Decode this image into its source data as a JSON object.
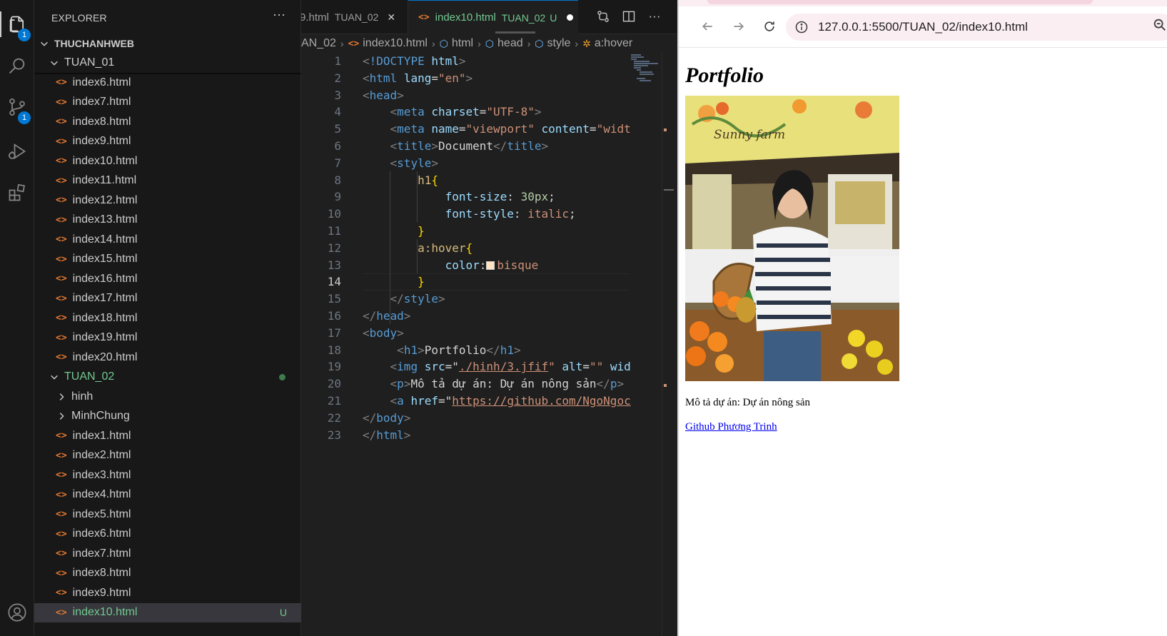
{
  "activity_bar": {
    "items": [
      {
        "name": "explorer",
        "badge": "1"
      },
      {
        "name": "search"
      },
      {
        "name": "source-control",
        "badge": "1"
      },
      {
        "name": "run-debug"
      },
      {
        "name": "extensions"
      },
      {
        "name": "accounts"
      }
    ]
  },
  "explorer": {
    "title": "EXPLORER",
    "more": "···",
    "root": "THUCHANHWEB",
    "folder1": "TUAN_01",
    "folder1_files": [
      "index6.html",
      "index7.html",
      "index8.html",
      "index9.html",
      "index10.html",
      "index11.html",
      "index12.html",
      "index13.html",
      "index14.html",
      "index15.html",
      "index16.html",
      "index17.html",
      "index18.html",
      "index19.html",
      "index20.html"
    ],
    "folder2": "TUAN_02",
    "folder2_subfolders": [
      "hinh",
      "MinhChung"
    ],
    "folder2_files": [
      "index1.html",
      "index2.html",
      "index3.html",
      "index4.html",
      "index5.html",
      "index6.html",
      "index7.html",
      "index8.html",
      "index9.html"
    ],
    "selected_file": "index10.html",
    "selected_status": "U",
    "file_icon": "<>"
  },
  "editor": {
    "tabs": [
      {
        "label": "9.html",
        "desc": "TUAN_02",
        "close": "✕"
      },
      {
        "label": "index10.html",
        "desc": "TUAN_02",
        "status": "U"
      }
    ],
    "breadcrumb": [
      "AN_02",
      "index10.html",
      "html",
      "head",
      "style",
      "a:hover"
    ],
    "lines": [
      {
        "n": "1"
      },
      {
        "n": "2"
      },
      {
        "n": "3"
      },
      {
        "n": "4"
      },
      {
        "n": "5"
      },
      {
        "n": "6"
      },
      {
        "n": "7"
      },
      {
        "n": "8"
      },
      {
        "n": "9"
      },
      {
        "n": "10"
      },
      {
        "n": "11"
      },
      {
        "n": "12"
      },
      {
        "n": "13"
      },
      {
        "n": "14"
      },
      {
        "n": "15"
      },
      {
        "n": "16"
      },
      {
        "n": "17"
      },
      {
        "n": "18"
      },
      {
        "n": "19"
      },
      {
        "n": "20"
      },
      {
        "n": "21"
      },
      {
        "n": "22"
      },
      {
        "n": "23"
      }
    ],
    "current_line": "14",
    "code": {
      "doctype_kw": "!DOCTYPE",
      "doctype_val": "html",
      "html": "html",
      "lang_attr": "lang",
      "lang_val": "\"en\"",
      "head": "head",
      "meta": "meta",
      "charset_attr": "charset",
      "charset_val": "\"UTF-8\"",
      "name_attr": "name",
      "name_val": "\"viewport\"",
      "content_attr": "content",
      "content_val": "\"widt",
      "title": "title",
      "title_text": "Document",
      "style": "style",
      "h1_sel": "h1",
      "open_brace": "{",
      "close_brace": "}",
      "fs_prop": "font-size",
      "fs_val": "30px",
      "fst_prop": "font-style",
      "fst_val": "italic",
      "ahover_sel": "a:hover",
      "color_prop": "color",
      "color_val": "bisque",
      "body": "body",
      "h1_tag": "h1",
      "h1_text": "Portfolio",
      "img": "img",
      "src_attr": "src",
      "src_val": "./hinh/3.jfif",
      "alt_attr": "alt",
      "alt_val": "\"\"",
      "wid_attr": "wid",
      "p": "p",
      "p_text": "Mô tả dự án: Dự án nông sản",
      "a": "a",
      "href_attr": "href",
      "href_val": "https://github.com/NgoNgoc"
    }
  },
  "browser": {
    "url": "127.0.0.1:5500/TUAN_02/index10.html",
    "page": {
      "heading": "Portfolio",
      "description": "Mô tả dự án: Dự án nông sản",
      "link_text": "Github Phương Trinh",
      "photo_sign": "Sunny farm"
    }
  },
  "colors": {
    "accent": "#0078d4",
    "git_untracked": "#73c991",
    "html_icon": "#e37933",
    "bisque": "#ffe4c4"
  }
}
